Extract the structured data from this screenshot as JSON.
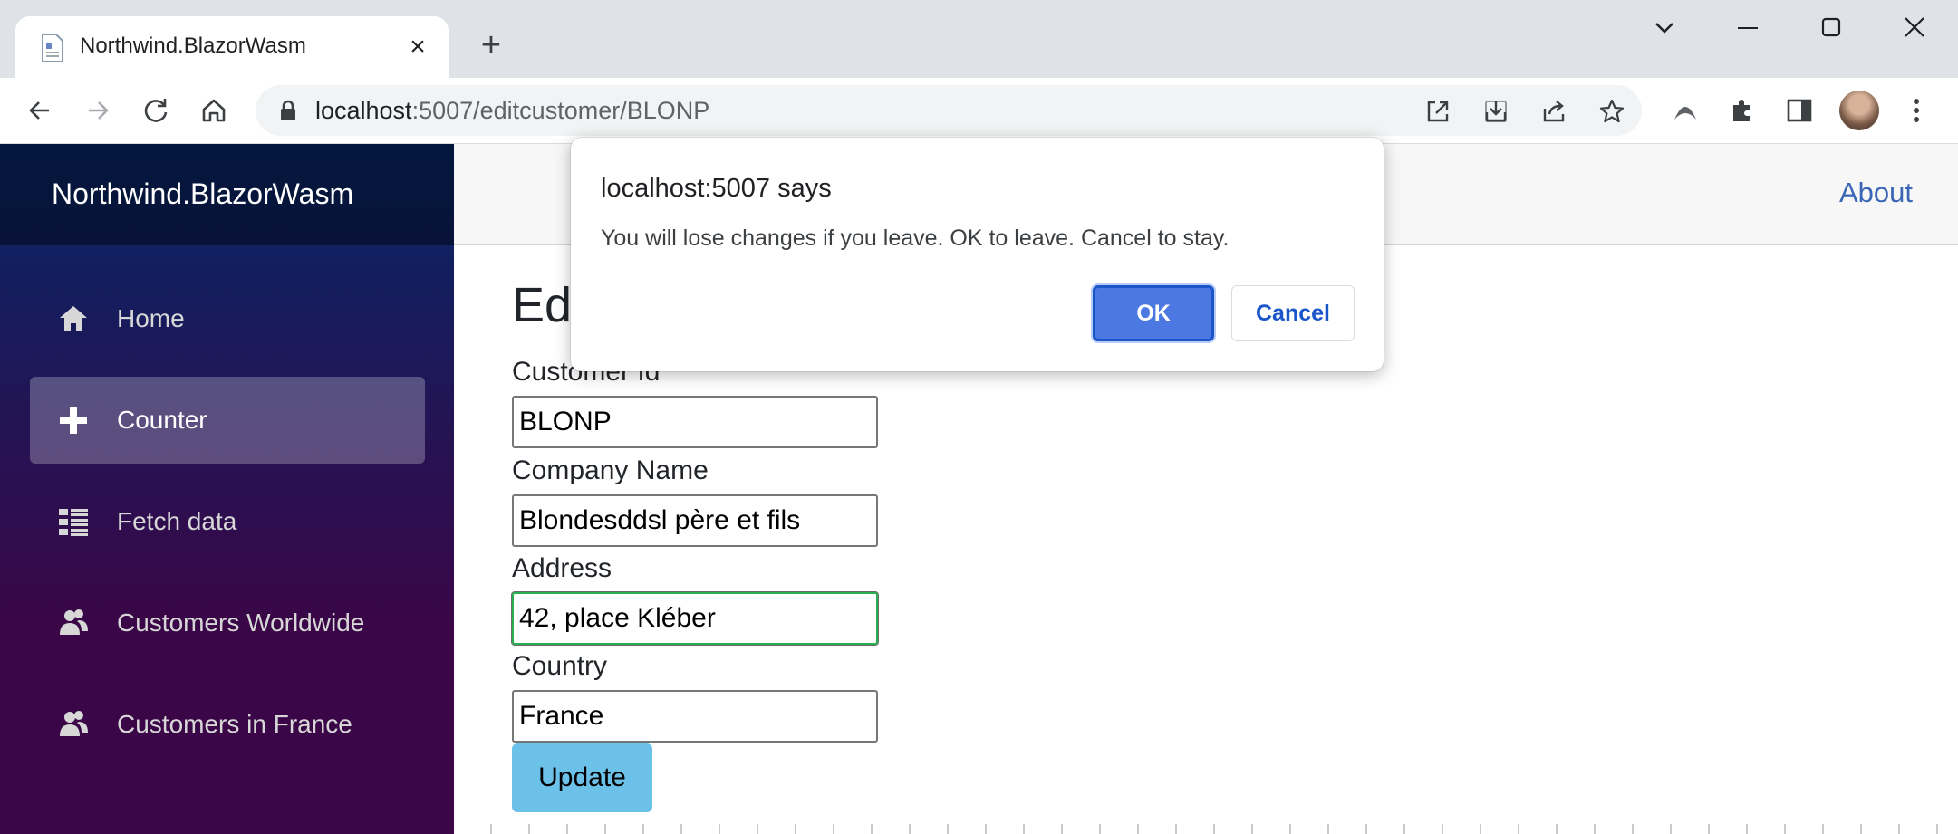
{
  "browser": {
    "tab_title": "Northwind.BlazorWasm",
    "close_glyph": "×",
    "new_tab_glyph": "+",
    "url_host": "localhost",
    "url_path": ":5007/editcustomer/BLONP"
  },
  "app": {
    "brand": "Northwind.BlazorWasm",
    "about_link": "About",
    "nav": [
      {
        "label": "Home",
        "icon": "home-icon"
      },
      {
        "label": "Counter",
        "icon": "plus-icon",
        "active": true
      },
      {
        "label": "Fetch data",
        "icon": "list-icon"
      },
      {
        "label": "Customers Worldwide",
        "icon": "people-icon"
      },
      {
        "label": "Customers in France",
        "icon": "people-icon"
      }
    ]
  },
  "form": {
    "title": "Ed",
    "fields": [
      {
        "label": "Customer Id",
        "value": "BLONP"
      },
      {
        "label": "Company Name",
        "value": "Blondesddsl père et fils"
      },
      {
        "label": "Address",
        "value": "42, place Kléber"
      },
      {
        "label": "Country",
        "value": "France"
      }
    ],
    "submit_label": "Update"
  },
  "dialog": {
    "title": "localhost:5007 says",
    "message": "You will lose changes if you leave. OK to leave. Cancel to stay.",
    "ok_label": "OK",
    "cancel_label": "Cancel"
  },
  "colors": {
    "sidebar_top": "#052767",
    "sidebar_bottom": "#3a0647",
    "link": "#3b66b5",
    "ok_button": "#4c79e1",
    "update_button": "#6cc1e9"
  }
}
